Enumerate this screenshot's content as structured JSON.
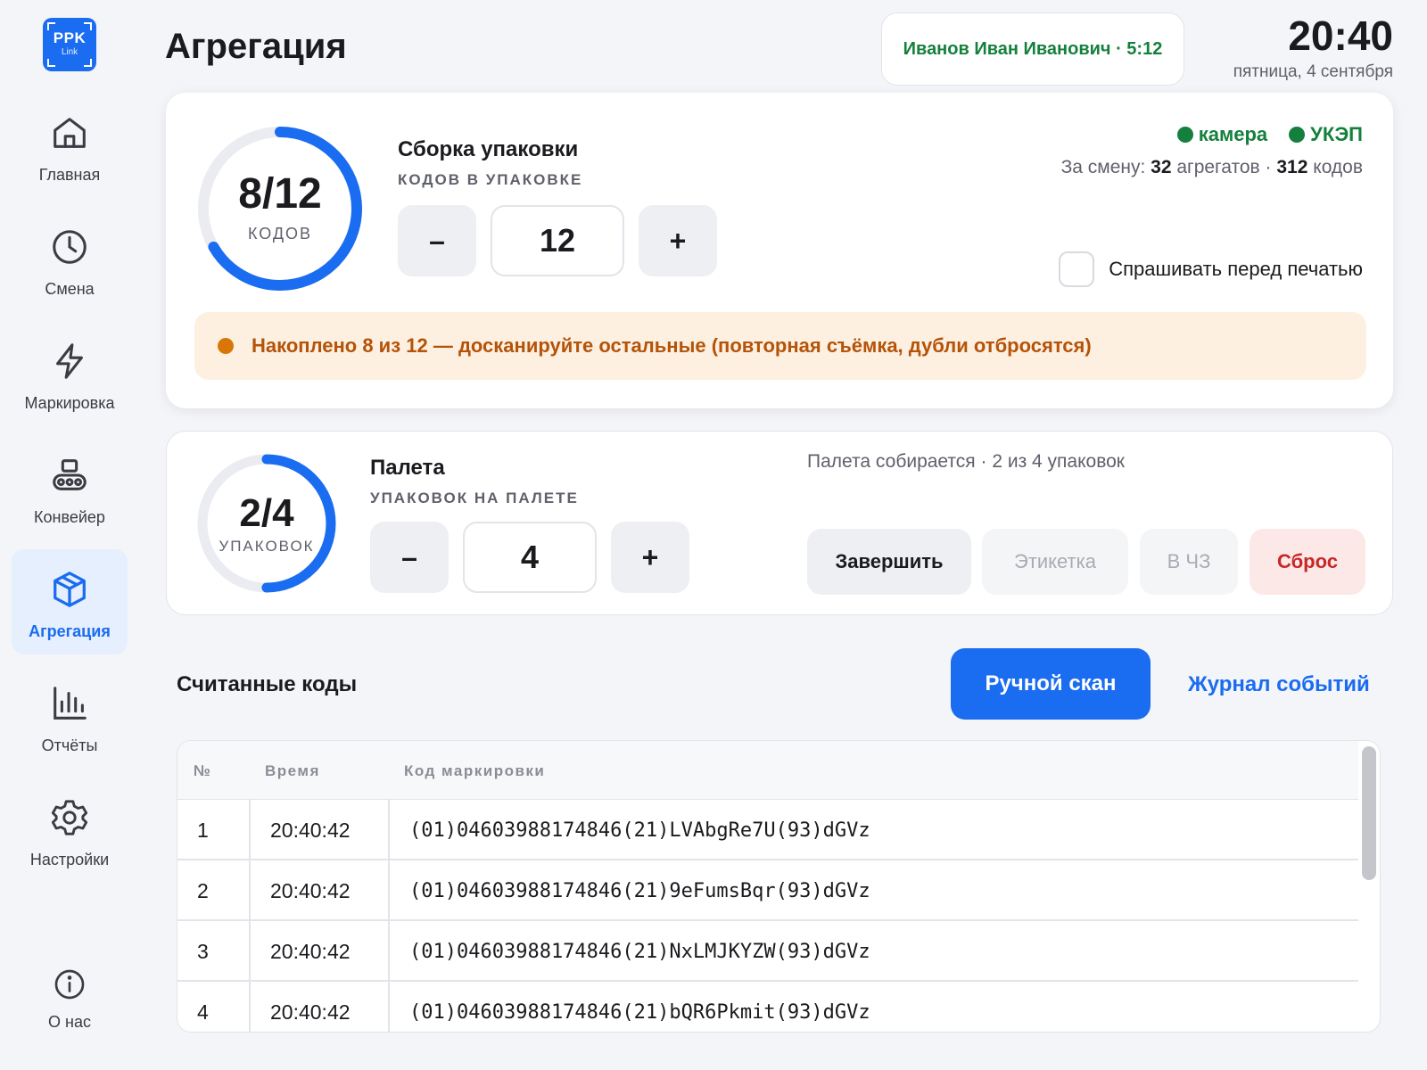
{
  "logo": {
    "line1": "PPK",
    "line2": "Link"
  },
  "sidebar": {
    "items": [
      {
        "label": "Главная",
        "icon": "home-icon",
        "active": false
      },
      {
        "label": "Смена",
        "icon": "clock-icon",
        "active": false
      },
      {
        "label": "Маркировка",
        "icon": "lightning-icon",
        "active": false
      },
      {
        "label": "Конвейер",
        "icon": "conveyor-icon",
        "active": false
      },
      {
        "label": "Агрегация",
        "icon": "box-icon",
        "active": true
      },
      {
        "label": "Отчёты",
        "icon": "chart-icon",
        "active": false
      },
      {
        "label": "Настройки",
        "icon": "gear-icon",
        "active": false
      }
    ],
    "about": {
      "label": "О нас",
      "icon": "info-icon"
    }
  },
  "header": {
    "title": "Агрегация",
    "user": "Иванов Иван Иванович · 5:12",
    "time": "20:40",
    "date": "пятница, 4 сентября"
  },
  "package": {
    "progress_value": "8/12",
    "progress_unit": "КОДОВ",
    "current": 8,
    "target": 12,
    "title": "Сборка упаковки",
    "subtitle": "КОДОВ В УПАКОВКЕ",
    "stepper_value": "12",
    "minus": "–",
    "plus": "+",
    "status_camera": "камера",
    "status_ukep": "УКЭП",
    "shift_prefix": "За смену:",
    "shift_aggregates_count": "32",
    "shift_aggregates_label": "агрегатов ·",
    "shift_codes_count": "312",
    "shift_codes_label": "кодов",
    "ask_print_label": "Спрашивать перед печатью",
    "warning": "Накоплено 8 из 12 — досканируйте остальные (повторная съёмка, дубли отбросятся)"
  },
  "pallet": {
    "progress_value": "2/4",
    "progress_unit": "УПАКОВОК",
    "current": 2,
    "target": 4,
    "title": "Палета",
    "subtitle": "УПАКОВОК НА ПАЛЕТЕ",
    "stepper_value": "4",
    "minus": "–",
    "plus": "+",
    "status": "Палета собирается · 2 из 4 упаковок",
    "buttons": {
      "finish": "Завершить",
      "label": "Этикетка",
      "cz": "В ЧЗ",
      "reset": "Сброс"
    }
  },
  "codes": {
    "title": "Считанные коды",
    "manual_scan": "Ручной скан",
    "journal": "Журнал событий",
    "columns": {
      "no": "№",
      "time": "Время",
      "code": "Код маркировки"
    },
    "rows": [
      {
        "no": "1",
        "time": "20:40:42",
        "code": "(01)04603988174846(21)LVAbgRe7U(93)dGVz"
      },
      {
        "no": "2",
        "time": "20:40:42",
        "code": "(01)04603988174846(21)9eFumsBqr(93)dGVz"
      },
      {
        "no": "3",
        "time": "20:40:42",
        "code": "(01)04603988174846(21)NxLMJKYZW(93)dGVz"
      },
      {
        "no": "4",
        "time": "20:40:42",
        "code": "(01)04603988174846(21)bQR6Pkmit(93)dGVz"
      }
    ]
  },
  "colors": {
    "accent": "#1a6cf0",
    "success": "#15803d",
    "warning_text": "#b45309",
    "warning_bg": "#fdf0e1",
    "danger": "#c62828",
    "ring_track": "#ebecf1"
  }
}
